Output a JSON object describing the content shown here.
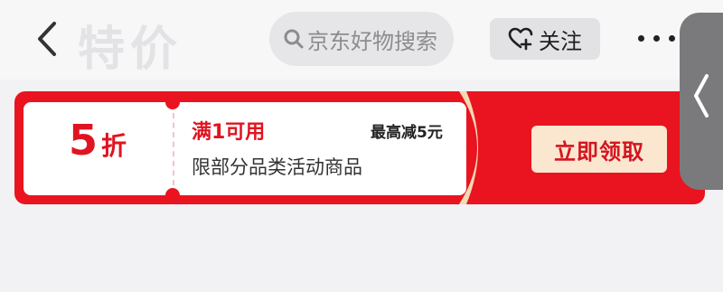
{
  "header": {
    "title": "特价",
    "search_placeholder": "京东好物搜索",
    "follow_label": "关注"
  },
  "coupon": {
    "discount_value": "5",
    "discount_unit": "折",
    "condition": "满1可用",
    "max_discount": "最高减5元",
    "scope": "限部分品类活动商品",
    "claim_label": "立即领取"
  },
  "colors": {
    "brand_red": "#e9141f",
    "claim_bg": "#fbe7cf"
  },
  "icons": [
    "back-arrow-icon",
    "search-icon",
    "heart-plus-icon",
    "more-icon",
    "chevron-left-icon"
  ]
}
